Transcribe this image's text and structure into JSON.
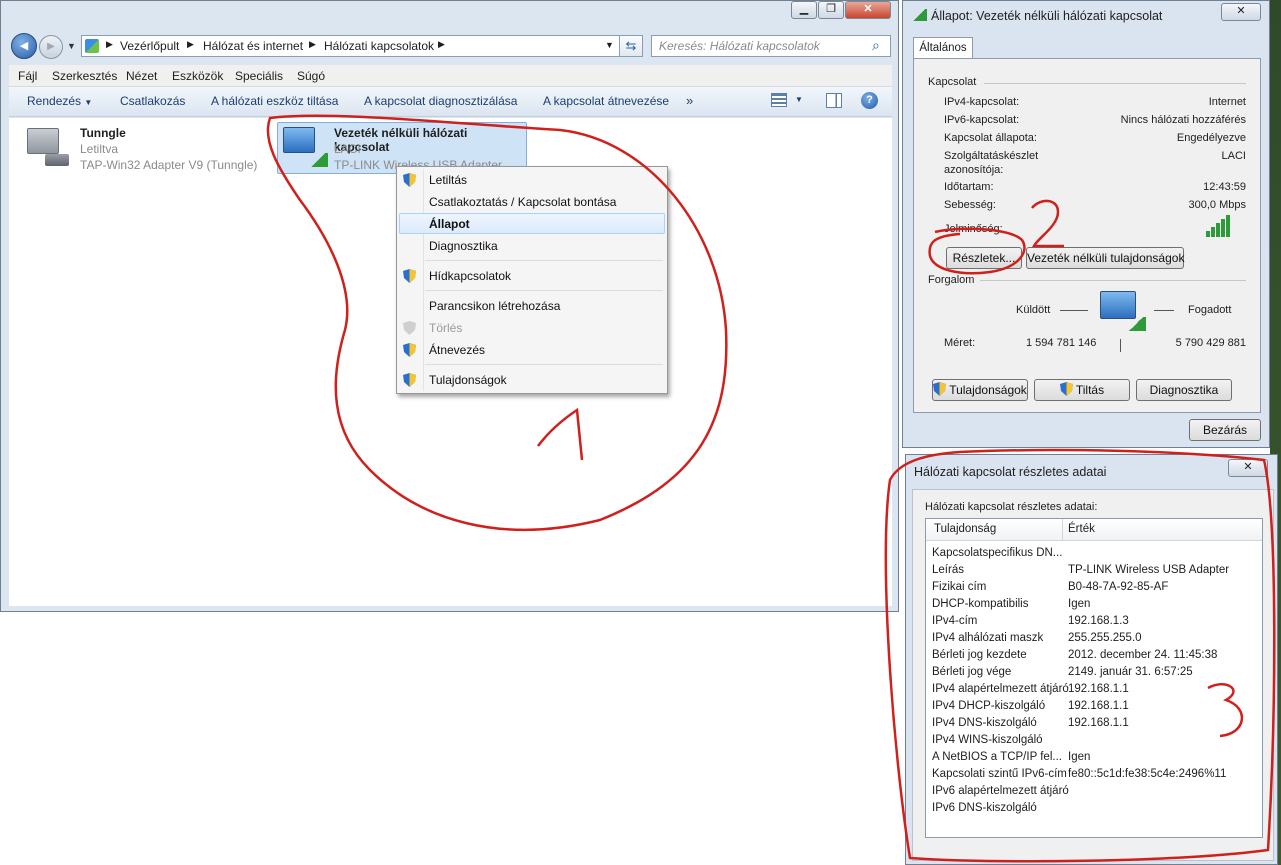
{
  "explorer": {
    "nav": {
      "back_label": "◀",
      "forward_label": "▶"
    },
    "breadcrumb": [
      "Vezérlőpult",
      "Hálózat és internet",
      "Hálózati kapcsolatok"
    ],
    "search_placeholder": "Keresés: Hálózati kapcsolatok",
    "menu": [
      "Fájl",
      "Szerkesztés",
      "Nézet",
      "Eszközök",
      "Speciális",
      "Súgó"
    ],
    "toolbar": {
      "organize": "Rendezés",
      "connect": "Csatlakozás",
      "disable": "A hálózati eszköz tiltása",
      "diagnose": "A kapcsolat diagnosztizálása",
      "rename": "A kapcsolat átnevezése",
      "more": "»"
    },
    "connections": [
      {
        "name": "Tunngle",
        "status": "Letiltva",
        "adapter": "TAP-Win32 Adapter V9 (Tunngle)"
      },
      {
        "name": "Vezeték nélküli hálózati kapcsolat",
        "status": "LACI",
        "adapter": "TP-LINK Wireless USB Adapter"
      }
    ]
  },
  "context_menu": {
    "items": [
      {
        "label": "Letiltás",
        "shield": true
      },
      {
        "label": "Csatlakoztatás / Kapcsolat bontása",
        "shield": false
      },
      {
        "label": "Állapot",
        "shield": false,
        "bold": true
      },
      {
        "label": "Diagnosztika",
        "shield": false
      },
      {
        "label": "Hídkapcsolatok",
        "shield": true
      },
      {
        "label": "Parancsikon létrehozása",
        "shield": false
      },
      {
        "label": "Törlés",
        "shield": true,
        "disabled": true
      },
      {
        "label": "Átnevezés",
        "shield": true
      },
      {
        "label": "Tulajdonságok",
        "shield": true
      }
    ]
  },
  "status_dialog": {
    "title": "Állapot: Vezeték nélküli hálózati kapcsolat",
    "tab": "Általános",
    "connection_group": "Kapcsolat",
    "rows": [
      {
        "label": "IPv4-kapcsolat:",
        "value": "Internet"
      },
      {
        "label": "IPv6-kapcsolat:",
        "value": "Nincs hálózati hozzáférés"
      },
      {
        "label": "Kapcsolat állapota:",
        "value": "Engedélyezve"
      },
      {
        "label": "Szolgáltatáskészlet azonosítója:",
        "value": "LACI"
      },
      {
        "label": "Időtartam:",
        "value": "12:43:59"
      },
      {
        "label": "Sebesség:",
        "value": "300,0 Mbps"
      },
      {
        "label": "Jelminőség:",
        "value": ""
      }
    ],
    "details_button": "Részletek...",
    "wireless_props_button": "Vezeték nélküli tulajdonságok",
    "traffic_group": "Forgalom",
    "sent_label": "Küldött",
    "received_label": "Fogadott",
    "size_label": "Méret:",
    "sent_value": "1 594 781 146",
    "received_value": "5 790 429 881",
    "properties_button": "Tulajdonságok",
    "disable_button": "Tiltás",
    "diagnose_button": "Diagnosztika",
    "close_button": "Bezárás"
  },
  "details_dialog": {
    "title": "Hálózati kapcsolat részletes adatai",
    "caption": "Hálózati kapcsolat részletes adatai:",
    "col_property": "Tulajdonság",
    "col_value": "Érték",
    "rows": [
      {
        "p": "Kapcsolatspecifikus DN...",
        "v": ""
      },
      {
        "p": "Leírás",
        "v": "TP-LINK Wireless USB Adapter"
      },
      {
        "p": "Fizikai cím",
        "v": "B0-48-7A-92-85-AF"
      },
      {
        "p": "DHCP-kompatibilis",
        "v": "Igen"
      },
      {
        "p": "IPv4-cím",
        "v": "192.168.1.3"
      },
      {
        "p": "IPv4 alhálózati maszk",
        "v": "255.255.255.0"
      },
      {
        "p": "Bérleti jog kezdete",
        "v": "2012. december 24. 11:45:38"
      },
      {
        "p": "Bérleti jog vége",
        "v": "2149. január 31. 6:57:25"
      },
      {
        "p": "IPv4 alapértelmezett átjáró",
        "v": "192.168.1.1"
      },
      {
        "p": "IPv4 DHCP-kiszolgáló",
        "v": "192.168.1.1"
      },
      {
        "p": "IPv4 DNS-kiszolgáló",
        "v": "192.168.1.1"
      },
      {
        "p": "IPv4 WINS-kiszolgáló",
        "v": ""
      },
      {
        "p": "A NetBIOS a TCP/IP fel...",
        "v": "Igen"
      },
      {
        "p": "Kapcsolati szintű IPv6-cím",
        "v": "fe80::5c1d:fe38:5c4e:2496%11"
      },
      {
        "p": "IPv6 alapértelmezett átjáró",
        "v": ""
      },
      {
        "p": "IPv6 DNS-kiszolgáló",
        "v": ""
      }
    ]
  },
  "annotations": {
    "one": "1",
    "two": "2",
    "three": "3"
  },
  "colors": {
    "annotation": "#d0201c",
    "toolbar_text": "#1c3f6e",
    "selection": "#cfe3f7"
  }
}
